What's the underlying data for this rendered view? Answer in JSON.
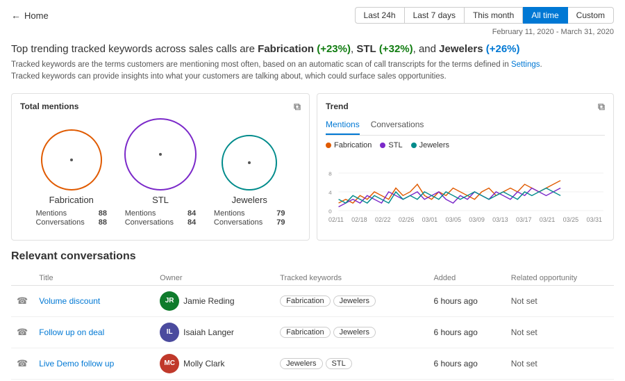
{
  "header": {
    "back_label": "Home",
    "time_filters": [
      "Last 24h",
      "Last 7 days",
      "This month",
      "All time",
      "Custom"
    ],
    "active_filter": "All time"
  },
  "date_range": "February 11, 2020 - March 31, 2020",
  "headline": {
    "prefix": "Top trending tracked keywords across sales calls are ",
    "kw1": "Fabrication",
    "kw1_pct": "(+23%)",
    "mid": ", ",
    "kw2": "STL",
    "kw2_pct": "(+32%)",
    "end": ", and ",
    "kw3": "Jewelers",
    "kw3_pct": "(+26%)"
  },
  "description": {
    "line1": "Tracked keywords are the terms customers are mentioning most often, based on an automatic scan of call transcripts for the terms defined in Settings.",
    "line2": "Tracked keywords can provide insights into what your customers are talking about, which could surface sales opportunities.",
    "settings_link": "Settings"
  },
  "total_mentions": {
    "title": "Total mentions",
    "bubbles": [
      {
        "label": "Fabrication",
        "mentions": 88,
        "conversations": 88,
        "size": 88,
        "color": "#e05a00"
      },
      {
        "label": "STL",
        "mentions": 84,
        "conversations": 84,
        "size": 104,
        "color": "#7b29c9"
      },
      {
        "label": "Jewelers",
        "mentions": 79,
        "conversations": 79,
        "size": 80,
        "color": "#008b8b"
      }
    ]
  },
  "trend": {
    "title": "Trend",
    "tabs": [
      "Mentions",
      "Conversations"
    ],
    "active_tab": "Mentions",
    "legend": [
      {
        "label": "Fabrication",
        "color": "#e05a00"
      },
      {
        "label": "STL",
        "color": "#7b29c9"
      },
      {
        "label": "Jewelers",
        "color": "#008b8b"
      }
    ],
    "x_labels": [
      "02/11",
      "02/18",
      "02/22",
      "02/26",
      "03/01",
      "03/05",
      "03/09",
      "03/13",
      "03/17",
      "03/21",
      "03/25",
      "03/31"
    ],
    "y_labels": [
      "0",
      "4",
      "8"
    ],
    "fabrication_data": [
      2,
      3,
      2,
      4,
      3,
      5,
      4,
      3,
      6,
      4,
      5,
      7,
      4,
      3,
      5,
      4,
      6,
      5,
      4,
      3,
      5,
      6,
      4,
      5,
      6,
      5,
      7,
      6,
      5,
      6,
      7,
      8
    ],
    "stl_data": [
      1,
      2,
      3,
      2,
      4,
      3,
      2,
      5,
      4,
      3,
      4,
      5,
      3,
      4,
      5,
      3,
      2,
      4,
      3,
      5,
      4,
      3,
      5,
      4,
      3,
      5,
      4,
      6,
      5,
      4,
      5,
      6
    ],
    "jewelers_data": [
      3,
      2,
      4,
      3,
      2,
      4,
      3,
      2,
      5,
      3,
      4,
      3,
      5,
      4,
      3,
      5,
      4,
      3,
      4,
      5,
      4,
      3,
      4,
      5,
      4,
      3,
      5,
      4,
      5,
      6,
      5,
      4
    ]
  },
  "conversations": {
    "section_title": "Relevant conversations",
    "columns": [
      "Title",
      "Owner",
      "Tracked keywords",
      "Added",
      "Related opportunity"
    ],
    "rows": [
      {
        "title": "Volume discount",
        "owner_name": "Jamie Reding",
        "owner_initials": "JR",
        "owner_color": "#0f7b2c",
        "keywords": [
          "Fabrication",
          "Jewelers"
        ],
        "added": "6 hours ago",
        "related": "Not set"
      },
      {
        "title": "Follow up on deal",
        "owner_name": "Isaiah Langer",
        "owner_initials": "IL",
        "owner_color": "#4b4b9e",
        "keywords": [
          "Fabrication",
          "Jewelers"
        ],
        "added": "6 hours ago",
        "related": "Not set"
      },
      {
        "title": "Live Demo follow up",
        "owner_name": "Molly Clark",
        "owner_initials": "MC",
        "owner_color": "#c0392b",
        "keywords": [
          "Jewelers",
          "STL"
        ],
        "added": "6 hours ago",
        "related": "Not set"
      }
    ]
  },
  "icons": {
    "back": "←",
    "copy": "⧉",
    "phone": "📞"
  }
}
